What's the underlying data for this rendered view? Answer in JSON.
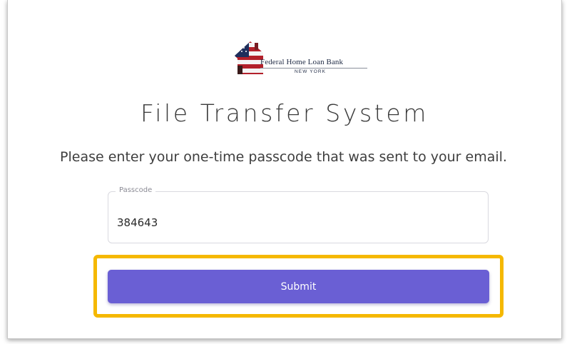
{
  "brand": {
    "name": "Federal Home Loan Bank",
    "location": "NEW YORK",
    "logo_icon": "flag-house-icon"
  },
  "header": {
    "title": "File Transfer System"
  },
  "main": {
    "instruction": "Please enter your one-time passcode that was sent to your email.",
    "passcode_field": {
      "label": "Passcode",
      "value": "384643"
    },
    "submit_label": "Submit"
  },
  "colors": {
    "accent": "#6a5fd4",
    "highlight": "#f5b800"
  }
}
